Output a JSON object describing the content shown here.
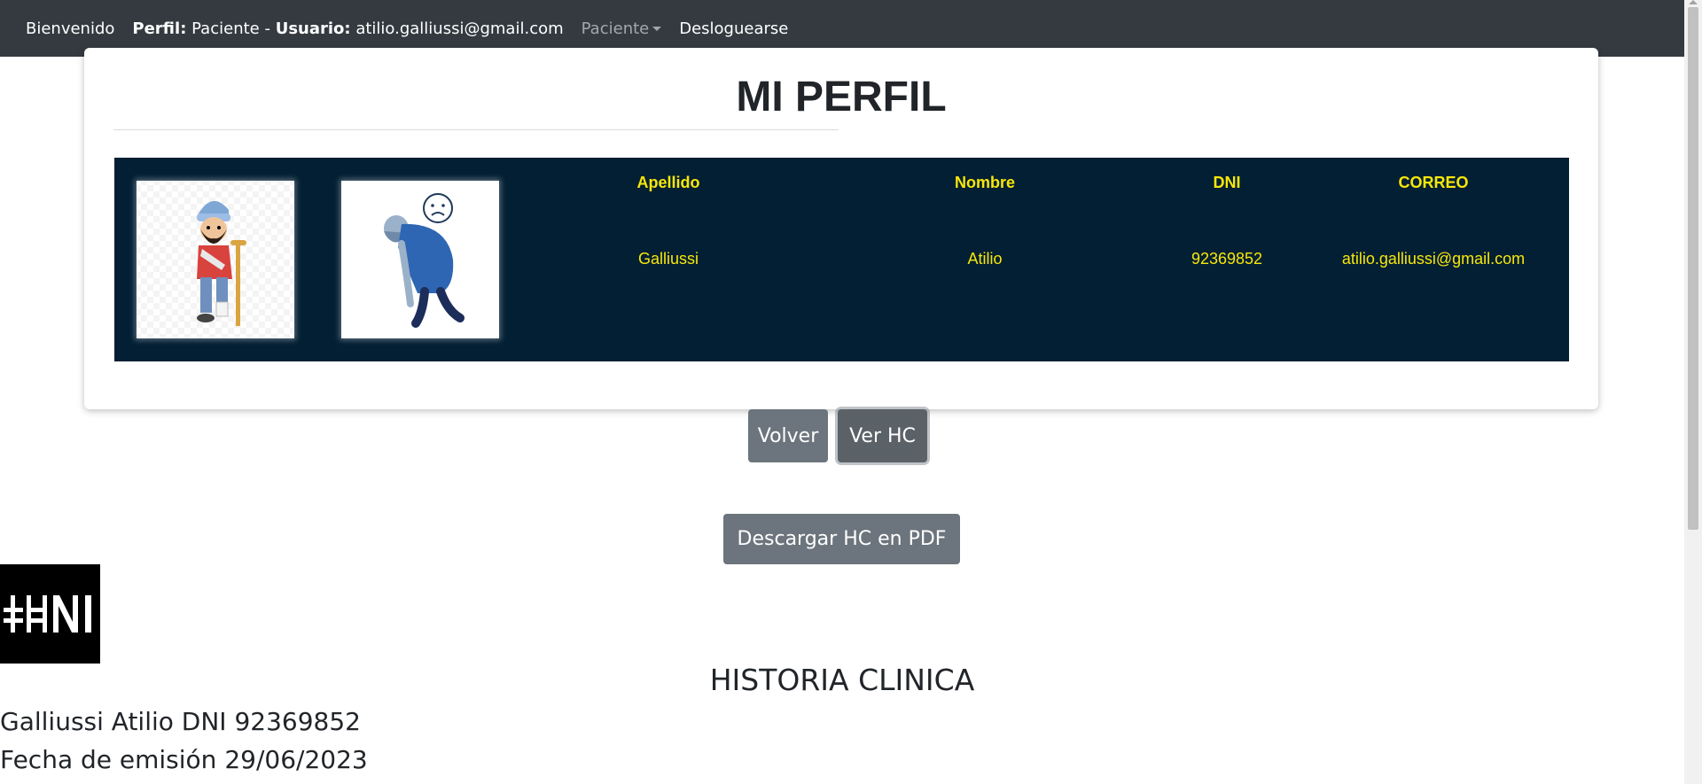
{
  "navbar": {
    "welcome": "Bienvenido",
    "profile_label": "Perfil:",
    "profile_value": "Paciente",
    "separator": "-",
    "user_label": "Usuario:",
    "user_value": "atilio.galliussi@gmail.com",
    "dropdown_label": "Paciente",
    "logout": "Desloguearse"
  },
  "profile": {
    "title": "MI PERFIL",
    "columns": [
      "Apellido",
      "Nombre",
      "DNI",
      "CORREO"
    ],
    "values": [
      "Galliussi",
      "Atilio",
      "92369852",
      "atilio.galliussi@gmail.com"
    ],
    "photos": [
      "patient-injured-photo",
      "patient-sad-photo"
    ]
  },
  "actions": {
    "back": "Volver",
    "view_hc": "Ver HC",
    "download_pdf": "Descargar HC en PDF"
  },
  "history": {
    "logo_text": "+HNI",
    "title": "HISTORIA CLINICA",
    "patient_line": "Galliussi Atilio DNI 92369852",
    "issue_date_line": "Fecha de emisión 29/06/2023"
  },
  "colors": {
    "navbar_bg": "#343a40",
    "table_bg": "#031f33",
    "table_text": "#f7e70a",
    "button_bg": "#6c757d"
  }
}
